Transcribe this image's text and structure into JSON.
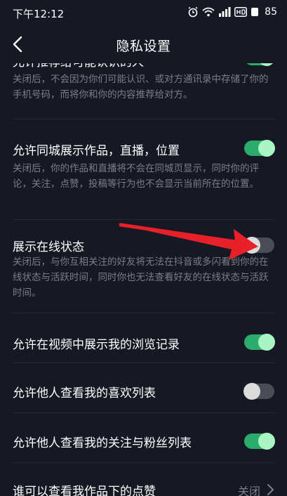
{
  "status_bar": {
    "time": "下午12:12",
    "battery": "85",
    "icons": [
      "alarm-icon",
      "wifi-icon",
      "signal-icon",
      "hd-icon",
      "battery-icon"
    ]
  },
  "nav": {
    "title": "隐私设置",
    "back_icon": "chevron-left-icon"
  },
  "settings": [
    {
      "title": "允许推荐给可能认识的人",
      "description": "关闭后，不会因为你们可能认识、或对方通讯录中存储了你的手机号码，而将你和你的内容推荐给对方。",
      "enabled": true
    },
    {
      "title": "允许同城展示作品，直播，位置",
      "description": "关闭后，你的作品和直播将不会在同城页显示，同时你的评论，关注，点赞，投稿等行为也不会显示当前所在的位置。",
      "enabled": true
    },
    {
      "title": "展示在线状态",
      "description": "关闭后，与你互相关注的好友将无法在抖音或多闪看到你的在线状态与活跃时间，同时你也无法查看好友的在线状态与活跃时间。",
      "enabled": false
    },
    {
      "title": "允许在视频中展示我的浏览记录",
      "enabled": true
    },
    {
      "title": "允许他人查看我的喜欢列表",
      "enabled": false
    },
    {
      "title": "允许他人查看我的关注与粉丝列表",
      "enabled": true
    },
    {
      "title": "谁可以查看我作品下的点赞",
      "value": "关闭"
    }
  ],
  "colors": {
    "background": "#161823",
    "toggle_on": "#2bab6c",
    "toggle_off": "#4b4d56",
    "annotation_arrow": "#e8202a"
  }
}
